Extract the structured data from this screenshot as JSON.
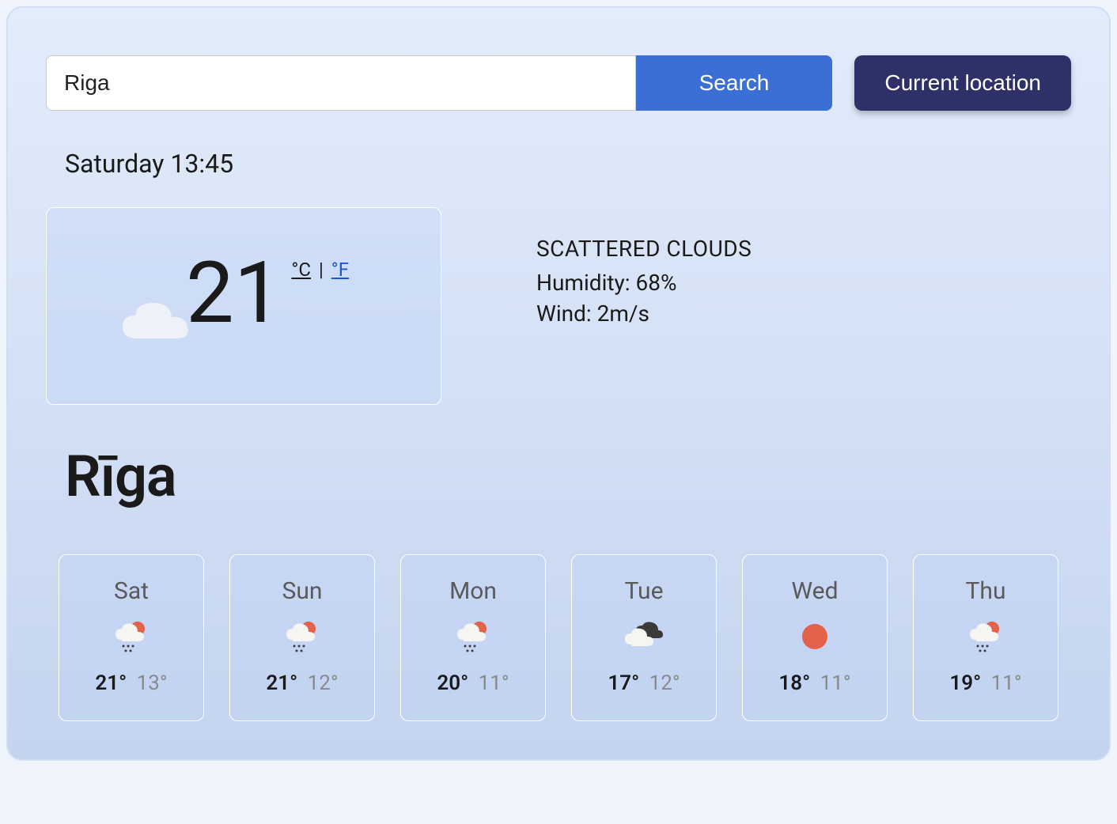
{
  "search": {
    "value": "Riga",
    "search_label": "Search",
    "current_location_label": "Current location"
  },
  "current": {
    "datetime": "Saturday 13:45",
    "temp": "21",
    "unit_c": "°C",
    "unit_sep": " | ",
    "unit_f": "°F",
    "conditions": "SCATTERED CLOUDS",
    "humidity_label": "Humidity: 68%",
    "wind_label": "Wind: 2m/s",
    "icon": "cloud"
  },
  "city": "Rīga",
  "forecast": [
    {
      "day": "Sat",
      "icon": "rain-sun",
      "high": "21°",
      "low": "13°"
    },
    {
      "day": "Sun",
      "icon": "rain-sun",
      "high": "21°",
      "low": "12°"
    },
    {
      "day": "Mon",
      "icon": "rain-sun",
      "high": "20°",
      "low": "11°"
    },
    {
      "day": "Tue",
      "icon": "cloudy",
      "high": "17°",
      "low": "12°"
    },
    {
      "day": "Wed",
      "icon": "sun",
      "high": "18°",
      "low": "11°"
    },
    {
      "day": "Thu",
      "icon": "rain-sun",
      "high": "19°",
      "low": "11°"
    }
  ]
}
